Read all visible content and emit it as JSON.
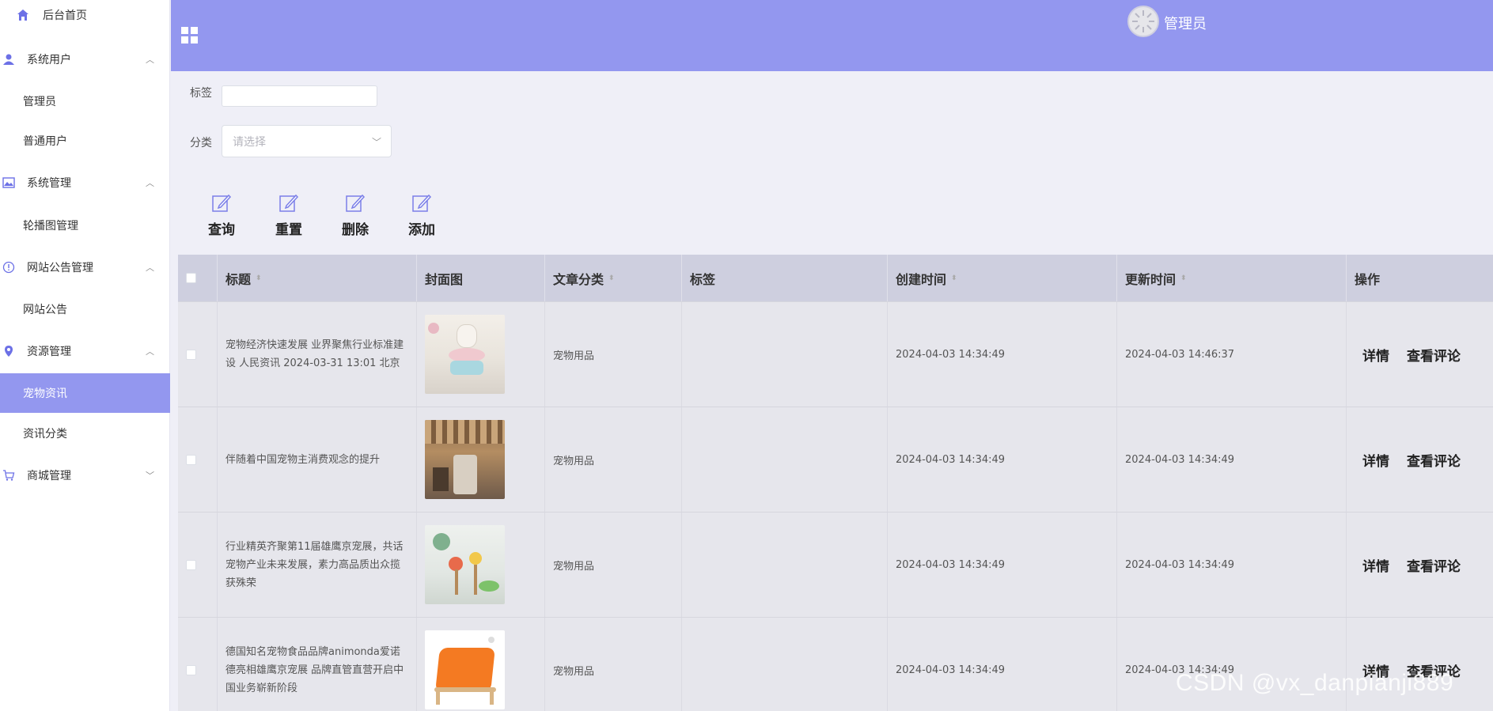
{
  "sidebar": {
    "home": "后台首页",
    "sys_users": "系统用户",
    "admin": "管理员",
    "normal_user": "普通用户",
    "sys_manage": "系统管理",
    "carousel": "轮播图管理",
    "notice_manage": "网站公告管理",
    "notice": "网站公告",
    "resource_manage": "资源管理",
    "pet_news": "宠物资讯",
    "news_category": "资讯分类",
    "mall_manage": "商城管理"
  },
  "header": {
    "user_name": "管理员"
  },
  "search": {
    "tag_label": "标签",
    "tag_value": "",
    "category_label": "分类",
    "category_placeholder": "请选择"
  },
  "actions": {
    "query": "查询",
    "reset": "重置",
    "delete": "删除",
    "add": "添加"
  },
  "table": {
    "columns": {
      "title": "标题",
      "cover": "封面图",
      "category": "文章分类",
      "tags": "标签",
      "created": "创建时间",
      "updated": "更新时间",
      "ops": "操作"
    },
    "op_detail": "详情",
    "op_comments": "查看评论",
    "rows": [
      {
        "title": "宠物经济快速发展 业界聚焦行业标准建设 人民资讯 2024-03-31 13:01 北京",
        "category": "宠物用品",
        "tags": "",
        "created": "2024-04-03 14:34:49",
        "updated": "2024-04-03 14:46:37"
      },
      {
        "title": "伴随着中国宠物主消费观念的提升",
        "category": "宠物用品",
        "tags": "",
        "created": "2024-04-03 14:34:49",
        "updated": "2024-04-03 14:34:49"
      },
      {
        "title": "行业精英齐聚第11届雄鹰京宠展，共话宠物产业未来发展，素力高品质出众揽获殊荣",
        "category": "宠物用品",
        "tags": "",
        "created": "2024-04-03 14:34:49",
        "updated": "2024-04-03 14:34:49"
      },
      {
        "title": "德国知名宠物食品品牌animonda爱诺德亮相雄鹰京宠展 品牌直管直营开启中国业务崭新阶段",
        "category": "宠物用品",
        "tags": "",
        "created": "2024-04-03 14:34:49",
        "updated": "2024-04-03 14:34:49"
      }
    ]
  },
  "watermark": "CSDN @vx_danpianji889",
  "colors": {
    "accent": "#9397ef",
    "header_bg": "#9397ef",
    "table_head": "#cecfdf"
  }
}
